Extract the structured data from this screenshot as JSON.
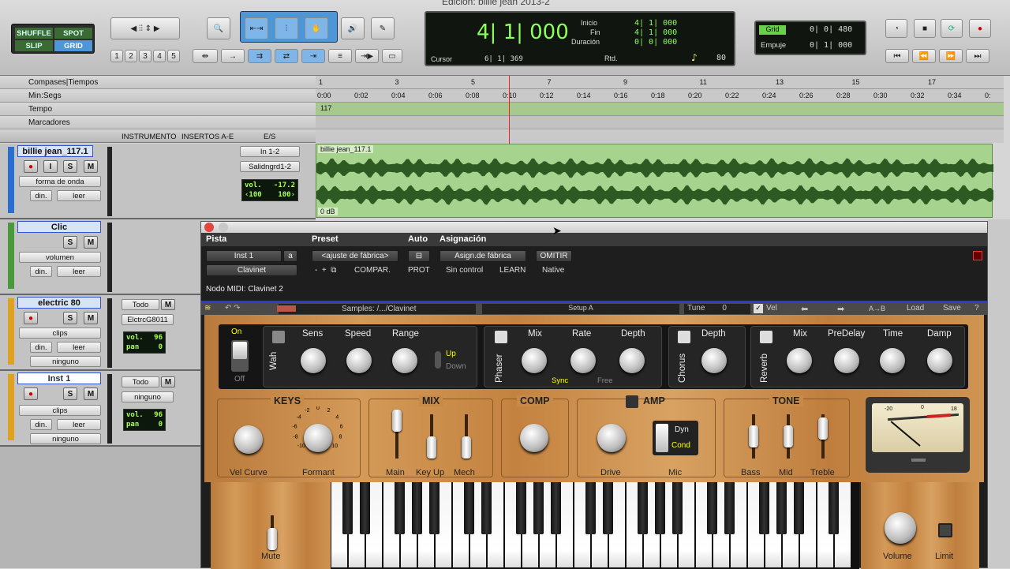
{
  "window": {
    "title": "Edición: billie jean 2013-2"
  },
  "toolbar": {
    "modes": {
      "shuffle": "SHUFFLE",
      "spot": "SPOT",
      "slip": "SLIP",
      "grid": "GRID"
    },
    "zoom_presets": [
      "1",
      "2",
      "3",
      "4",
      "5"
    ],
    "counter": {
      "main": "4| 1| 000",
      "inicio_label": "Inicio",
      "inicio": "4| 1| 000",
      "fin_label": "Fin",
      "fin": "4| 1| 000",
      "duracion_label": "Duración",
      "duracion": "0| 0| 000",
      "cursor_label": "Cursor",
      "cursor": "6| 1| 369",
      "tempo": "80",
      "rtd": "Rtd."
    },
    "grid": {
      "label": "Grid",
      "value": "0| 0| 480",
      "empuje_label": "Empuje",
      "empuje": "0| 1| 000"
    }
  },
  "rulers": [
    {
      "label": "Compases|Tiempos",
      "ticks": [
        "1",
        "3",
        "5",
        "7",
        "9",
        "11",
        "13",
        "15",
        "17"
      ]
    },
    {
      "label": "Min:Segs",
      "ticks": [
        "0:00",
        "0:02",
        "0:04",
        "0:06",
        "0:08",
        "0:10",
        "0:12",
        "0:14",
        "0:16",
        "0:18",
        "0:20",
        "0:22",
        "0:24",
        "0:26",
        "0:28",
        "0:30",
        "0:32",
        "0:34",
        "0:"
      ]
    },
    {
      "label": "Tempo",
      "value": "117"
    },
    {
      "label": "Marcadores"
    }
  ],
  "columns": {
    "instrumento": "INSTRUMENTO",
    "insertos": "INSERTOS A-E",
    "es": "E/S"
  },
  "tracks": [
    {
      "name": "billie jean_117.1",
      "view": "forma de onda",
      "dyn": "din.",
      "auto": "leer",
      "input": "In 1-2",
      "output": "Salidngrd1-2",
      "vol_label": "vol.",
      "vol": "-17.2",
      "pan_l": "‹100",
      "pan_r": "100›",
      "clip": "billie jean_117.1",
      "clip_gain": "0 dB"
    },
    {
      "name": "Clic",
      "view": "volumen",
      "dyn": "din.",
      "auto": "leer"
    },
    {
      "name": "electric 80",
      "view": "clips",
      "dyn": "din.",
      "auto": "leer",
      "group": "ninguno",
      "input": "Todo",
      "output": "ElctrcG8011",
      "vol_label": "vol.",
      "vol": "96",
      "pan_label": "pan",
      "pan": "0"
    },
    {
      "name": "Inst 1",
      "view": "clips",
      "dyn": "din.",
      "auto": "leer",
      "group": "ninguno",
      "input": "Todo",
      "output": "ninguno",
      "vol_label": "vol.",
      "vol": "96",
      "pan_label": "pan",
      "pan": "0"
    }
  ],
  "plugin": {
    "header": {
      "pista": "Pista",
      "preset": "Preset",
      "auto": "Auto",
      "asignacion": "Asignación"
    },
    "track_sel": "Inst 1",
    "track_letter": "a",
    "plugin_sel": "Clavinet",
    "preset_sel": "<ajuste de fábrica>",
    "compare": "COMPAR.",
    "prot": "PROT",
    "asign": "Asign.de fábrica",
    "sin_control": "Sin control",
    "learn": "LEARN",
    "omitir": "OMITIR",
    "native": "Native",
    "midi_node": "Nodo MIDI: Clavinet 2",
    "strip": {
      "samples": "Samples: /.../Clavinet",
      "setup": "Setup A",
      "tune": "Tune",
      "tune_val": "0",
      "vel": "Vel",
      "ab": "A→B",
      "load": "Load",
      "save": "Save",
      "help": "?"
    },
    "fx": {
      "on": "On",
      "off": "Off",
      "wah": "Wah",
      "sens": "Sens",
      "speed": "Speed",
      "range": "Range",
      "up": "Up",
      "down": "Down",
      "phaser": "Phaser",
      "mix": "Mix",
      "rate": "Rate",
      "depth": "Depth",
      "sync": "Sync",
      "free": "Free",
      "chorus": "Chorus",
      "chorus_depth": "Depth",
      "reverb": "Reverb",
      "rev_mix": "Mix",
      "predelay": "PreDelay",
      "time": "Time",
      "damp": "Damp"
    },
    "sections": {
      "keys": "KEYS",
      "vel_curve": "Vel Curve",
      "formant": "Formant",
      "mix": "MIX",
      "main": "Main",
      "keyup": "Key Up",
      "mech": "Mech",
      "comp": "COMP",
      "amp": "AMP",
      "drive": "Drive",
      "mic": "Mic",
      "dyn": "Dyn",
      "cond": "Cond",
      "tone": "TONE",
      "bass": "Bass",
      "mid": "Mid",
      "treble": "Treble",
      "mute": "Mute",
      "volume": "Volume",
      "limit": "Limit"
    },
    "formant_scale": [
      "-10",
      "-8",
      "-6",
      "-4",
      "-2",
      "0",
      "2",
      "4",
      "6",
      "8",
      "10"
    ],
    "vu_scale": [
      "-20",
      "0",
      "18"
    ]
  }
}
